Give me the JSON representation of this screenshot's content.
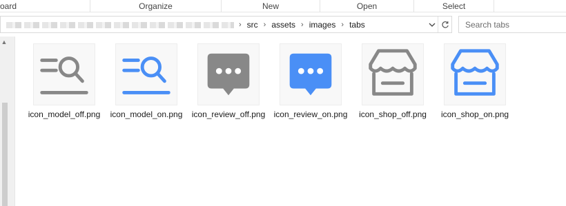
{
  "ribbon": {
    "groups": [
      "oard",
      "Organize",
      "New",
      "Open",
      "Select"
    ]
  },
  "address": {
    "path": [
      "src",
      "assets",
      "images",
      "tabs"
    ],
    "dropdown_icon": "chevron-down-icon",
    "refresh_icon": "refresh-icon"
  },
  "search": {
    "placeholder": "Search tabs"
  },
  "colors": {
    "icon_off": "#888888",
    "icon_on": "#4a8ff6"
  },
  "files": [
    {
      "name": "icon_model_off.png",
      "icon": "search-list-icon",
      "state": "off"
    },
    {
      "name": "icon_model_on.png",
      "icon": "search-list-icon",
      "state": "on"
    },
    {
      "name": "icon_review_off.png",
      "icon": "chat-bubble-icon",
      "state": "off"
    },
    {
      "name": "icon_review_on.png",
      "icon": "chat-bubble-icon",
      "state": "on"
    },
    {
      "name": "icon_shop_off.png",
      "icon": "shop-icon",
      "state": "off"
    },
    {
      "name": "icon_shop_on.png",
      "icon": "shop-icon",
      "state": "on"
    }
  ]
}
